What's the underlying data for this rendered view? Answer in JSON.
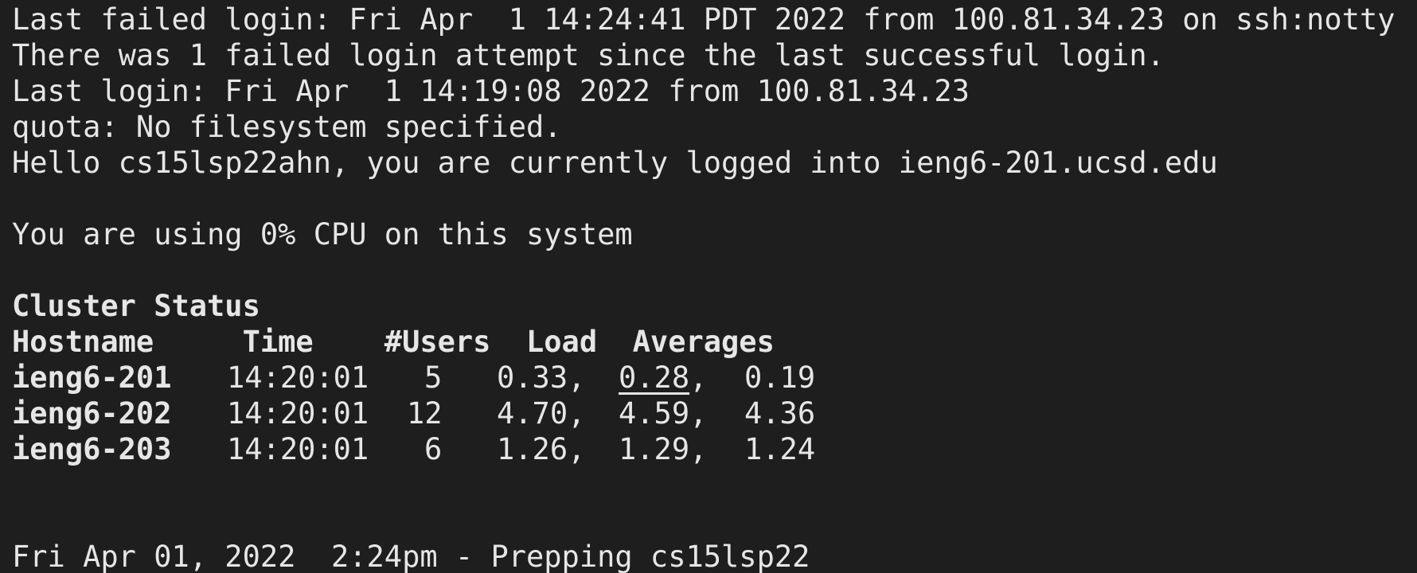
{
  "terminal": {
    "lines": [
      "Last failed login: Fri Apr  1 14:24:41 PDT 2022 from 100.81.34.23 on ssh:notty",
      "There was 1 failed login attempt since the last successful login.",
      "Last login: Fri Apr  1 14:19:08 2022 from 100.81.34.23",
      "quota: No filesystem specified.",
      "Hello cs15lsp22ahn, you are currently logged into ieng6-201.ucsd.edu",
      "You are using 0% CPU on this system"
    ],
    "cluster": {
      "title": "Cluster Status",
      "headers": "Hostname     Time    #Users  Load  Averages",
      "rows": [
        {
          "host": "ieng6-201",
          "time": "14:20:01",
          "users": "5",
          "load1": "0.33,",
          "load5": "0.28",
          "load5_sep": ",",
          "load15": "0.19"
        },
        {
          "host": "ieng6-202",
          "time": "14:20:01",
          "users": "12",
          "load1": "4.70,",
          "load5": "4.59",
          "load5_sep": ",",
          "load15": "4.36"
        },
        {
          "host": "ieng6-203",
          "time": "14:20:01",
          "users": "6",
          "load1": "1.26,",
          "load5": "1.29",
          "load5_sep": ",",
          "load15": "1.24"
        }
      ]
    },
    "footer": "Fri Apr 01, 2022  2:24pm - Prepping cs15lsp22"
  },
  "colors": {
    "background": "#1e1e1e",
    "foreground": "#e6e6e6"
  }
}
